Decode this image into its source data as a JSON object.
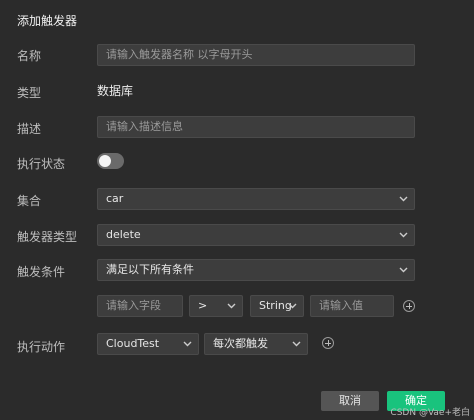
{
  "dialog": {
    "title": "添加触发器"
  },
  "form": {
    "name": {
      "label": "名称",
      "placeholder": "请输入触发器名称 以字母开头"
    },
    "type": {
      "label": "类型",
      "value": "数据库"
    },
    "description": {
      "label": "描述",
      "placeholder": "请输入描述信息"
    },
    "status": {
      "label": "执行状态",
      "enabled": false
    },
    "collection": {
      "label": "集合",
      "value": "car"
    },
    "trigger_type": {
      "label": "触发器类型",
      "value": "delete"
    },
    "conditions": {
      "label": "触发条件",
      "mode": "满足以下所有条件",
      "field_placeholder": "请输入字段",
      "operator": ">",
      "value_type": "String",
      "value_placeholder": "请输入值"
    },
    "action": {
      "label": "执行动作",
      "function": "CloudTest",
      "frequency": "每次都触发"
    }
  },
  "buttons": {
    "cancel": "取消",
    "confirm": "确定"
  },
  "watermark": "CSDN @Vae+老白",
  "icons": {
    "chevron": "chevron-down-icon",
    "add": "plus-circle-icon"
  },
  "colors": {
    "background": "#2b2b2b",
    "field": "#3d3d3d",
    "primary": "#19c37d"
  }
}
